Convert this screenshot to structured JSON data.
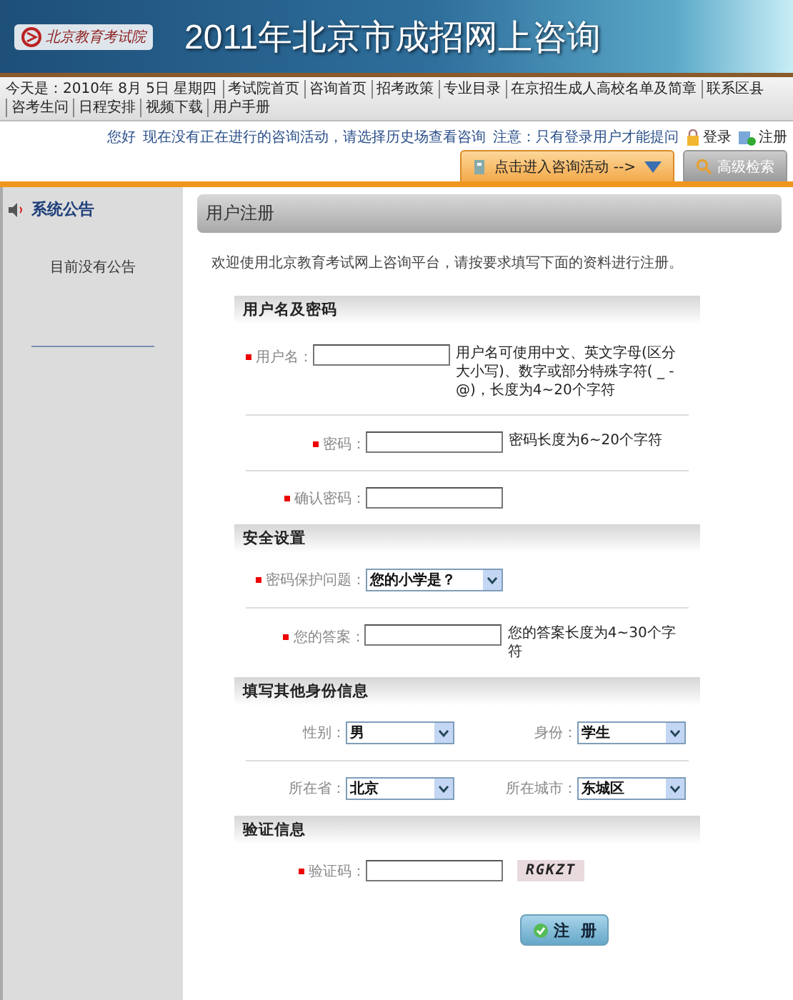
{
  "header": {
    "logo_text": "北京教育考试院",
    "title": "2011年北京市成招网上咨询"
  },
  "nav": {
    "date": "今天是：2010年 8月 5日 星期四",
    "links": [
      "考试院首页",
      "咨询首页",
      "招考政策",
      "专业目录",
      "在京招生成人高校名单及简章",
      "联系区县",
      "咨考生问",
      "日程安排",
      "视频下载",
      "用户手册"
    ]
  },
  "info": {
    "greeting": "您好",
    "message": "现在没有正在进行的咨询活动，请选择历史场查看咨询",
    "note": "注意：只有登录用户才能提问",
    "login": "登录",
    "register": "注册"
  },
  "actions": {
    "consult": "点击进入咨询活动 -->",
    "search": "高级检索"
  },
  "sidebar": {
    "title": "系统公告",
    "text": "目前没有公告"
  },
  "main": {
    "title": "用户注册",
    "intro": "欢迎使用北京教育考试网上咨询平台，请按要求填写下面的资料进行注册。",
    "sections": [
      {
        "title": "用户名及密码",
        "rows": [
          {
            "fields": [
              {
                "kind": "text",
                "label": "用户名：",
                "required": true,
                "hint": "用户名可使用中文、英文字母(区分大小写)、数字或部分特殊字符( _ - @)，长度为4~20个字符"
              }
            ]
          },
          {
            "fields": [
              {
                "kind": "text",
                "label": "密码：",
                "required": true,
                "hint": "密码长度为6~20个字符"
              }
            ]
          },
          {
            "fields": [
              {
                "kind": "text",
                "label": "确认密码：",
                "required": true
              }
            ]
          }
        ]
      },
      {
        "title": "安全设置",
        "rows": [
          {
            "fields": [
              {
                "kind": "select",
                "label": "密码保护问题：",
                "required": true,
                "value": "您的小学是？"
              }
            ]
          },
          {
            "fields": [
              {
                "kind": "text",
                "label": "您的答案：",
                "required": true,
                "hint": "您的答案长度为4~30个字符"
              }
            ]
          }
        ]
      },
      {
        "title": "填写其他身份信息",
        "rows": [
          {
            "fields": [
              {
                "kind": "select",
                "label": "性别：",
                "required": false,
                "value": "男"
              },
              {
                "kind": "select",
                "label": "身份：",
                "required": false,
                "value": "学生"
              }
            ]
          },
          {
            "fields": [
              {
                "kind": "select",
                "label": "所在省：",
                "required": false,
                "value": "北京"
              },
              {
                "kind": "select",
                "label": "所在城市：",
                "required": false,
                "value": "东城区"
              }
            ]
          }
        ]
      },
      {
        "title": "验证信息",
        "rows": [
          {
            "fields": [
              {
                "kind": "captcha",
                "label": "验证码：",
                "required": true,
                "code": "RGKZT"
              }
            ]
          }
        ]
      }
    ],
    "submit": "注  册"
  }
}
